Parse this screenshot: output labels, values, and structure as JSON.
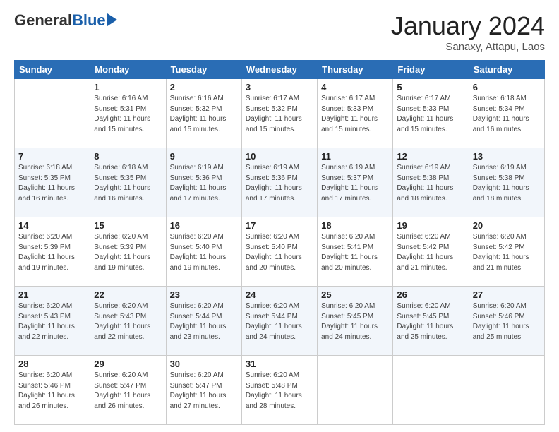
{
  "logo": {
    "general": "General",
    "blue": "Blue"
  },
  "header": {
    "month": "January 2024",
    "location": "Sanaxy, Attapu, Laos"
  },
  "weekdays": [
    "Sunday",
    "Monday",
    "Tuesday",
    "Wednesday",
    "Thursday",
    "Friday",
    "Saturday"
  ],
  "weeks": [
    [
      {
        "day": "",
        "info": ""
      },
      {
        "day": "1",
        "info": "Sunrise: 6:16 AM\nSunset: 5:31 PM\nDaylight: 11 hours\nand 15 minutes."
      },
      {
        "day": "2",
        "info": "Sunrise: 6:16 AM\nSunset: 5:32 PM\nDaylight: 11 hours\nand 15 minutes."
      },
      {
        "day": "3",
        "info": "Sunrise: 6:17 AM\nSunset: 5:32 PM\nDaylight: 11 hours\nand 15 minutes."
      },
      {
        "day": "4",
        "info": "Sunrise: 6:17 AM\nSunset: 5:33 PM\nDaylight: 11 hours\nand 15 minutes."
      },
      {
        "day": "5",
        "info": "Sunrise: 6:17 AM\nSunset: 5:33 PM\nDaylight: 11 hours\nand 15 minutes."
      },
      {
        "day": "6",
        "info": "Sunrise: 6:18 AM\nSunset: 5:34 PM\nDaylight: 11 hours\nand 16 minutes."
      }
    ],
    [
      {
        "day": "7",
        "info": "Sunrise: 6:18 AM\nSunset: 5:35 PM\nDaylight: 11 hours\nand 16 minutes."
      },
      {
        "day": "8",
        "info": "Sunrise: 6:18 AM\nSunset: 5:35 PM\nDaylight: 11 hours\nand 16 minutes."
      },
      {
        "day": "9",
        "info": "Sunrise: 6:19 AM\nSunset: 5:36 PM\nDaylight: 11 hours\nand 17 minutes."
      },
      {
        "day": "10",
        "info": "Sunrise: 6:19 AM\nSunset: 5:36 PM\nDaylight: 11 hours\nand 17 minutes."
      },
      {
        "day": "11",
        "info": "Sunrise: 6:19 AM\nSunset: 5:37 PM\nDaylight: 11 hours\nand 17 minutes."
      },
      {
        "day": "12",
        "info": "Sunrise: 6:19 AM\nSunset: 5:38 PM\nDaylight: 11 hours\nand 18 minutes."
      },
      {
        "day": "13",
        "info": "Sunrise: 6:19 AM\nSunset: 5:38 PM\nDaylight: 11 hours\nand 18 minutes."
      }
    ],
    [
      {
        "day": "14",
        "info": "Sunrise: 6:20 AM\nSunset: 5:39 PM\nDaylight: 11 hours\nand 19 minutes."
      },
      {
        "day": "15",
        "info": "Sunrise: 6:20 AM\nSunset: 5:39 PM\nDaylight: 11 hours\nand 19 minutes."
      },
      {
        "day": "16",
        "info": "Sunrise: 6:20 AM\nSunset: 5:40 PM\nDaylight: 11 hours\nand 19 minutes."
      },
      {
        "day": "17",
        "info": "Sunrise: 6:20 AM\nSunset: 5:40 PM\nDaylight: 11 hours\nand 20 minutes."
      },
      {
        "day": "18",
        "info": "Sunrise: 6:20 AM\nSunset: 5:41 PM\nDaylight: 11 hours\nand 20 minutes."
      },
      {
        "day": "19",
        "info": "Sunrise: 6:20 AM\nSunset: 5:42 PM\nDaylight: 11 hours\nand 21 minutes."
      },
      {
        "day": "20",
        "info": "Sunrise: 6:20 AM\nSunset: 5:42 PM\nDaylight: 11 hours\nand 21 minutes."
      }
    ],
    [
      {
        "day": "21",
        "info": "Sunrise: 6:20 AM\nSunset: 5:43 PM\nDaylight: 11 hours\nand 22 minutes."
      },
      {
        "day": "22",
        "info": "Sunrise: 6:20 AM\nSunset: 5:43 PM\nDaylight: 11 hours\nand 22 minutes."
      },
      {
        "day": "23",
        "info": "Sunrise: 6:20 AM\nSunset: 5:44 PM\nDaylight: 11 hours\nand 23 minutes."
      },
      {
        "day": "24",
        "info": "Sunrise: 6:20 AM\nSunset: 5:44 PM\nDaylight: 11 hours\nand 24 minutes."
      },
      {
        "day": "25",
        "info": "Sunrise: 6:20 AM\nSunset: 5:45 PM\nDaylight: 11 hours\nand 24 minutes."
      },
      {
        "day": "26",
        "info": "Sunrise: 6:20 AM\nSunset: 5:45 PM\nDaylight: 11 hours\nand 25 minutes."
      },
      {
        "day": "27",
        "info": "Sunrise: 6:20 AM\nSunset: 5:46 PM\nDaylight: 11 hours\nand 25 minutes."
      }
    ],
    [
      {
        "day": "28",
        "info": "Sunrise: 6:20 AM\nSunset: 5:46 PM\nDaylight: 11 hours\nand 26 minutes."
      },
      {
        "day": "29",
        "info": "Sunrise: 6:20 AM\nSunset: 5:47 PM\nDaylight: 11 hours\nand 26 minutes."
      },
      {
        "day": "30",
        "info": "Sunrise: 6:20 AM\nSunset: 5:47 PM\nDaylight: 11 hours\nand 27 minutes."
      },
      {
        "day": "31",
        "info": "Sunrise: 6:20 AM\nSunset: 5:48 PM\nDaylight: 11 hours\nand 28 minutes."
      },
      {
        "day": "",
        "info": ""
      },
      {
        "day": "",
        "info": ""
      },
      {
        "day": "",
        "info": ""
      }
    ]
  ]
}
